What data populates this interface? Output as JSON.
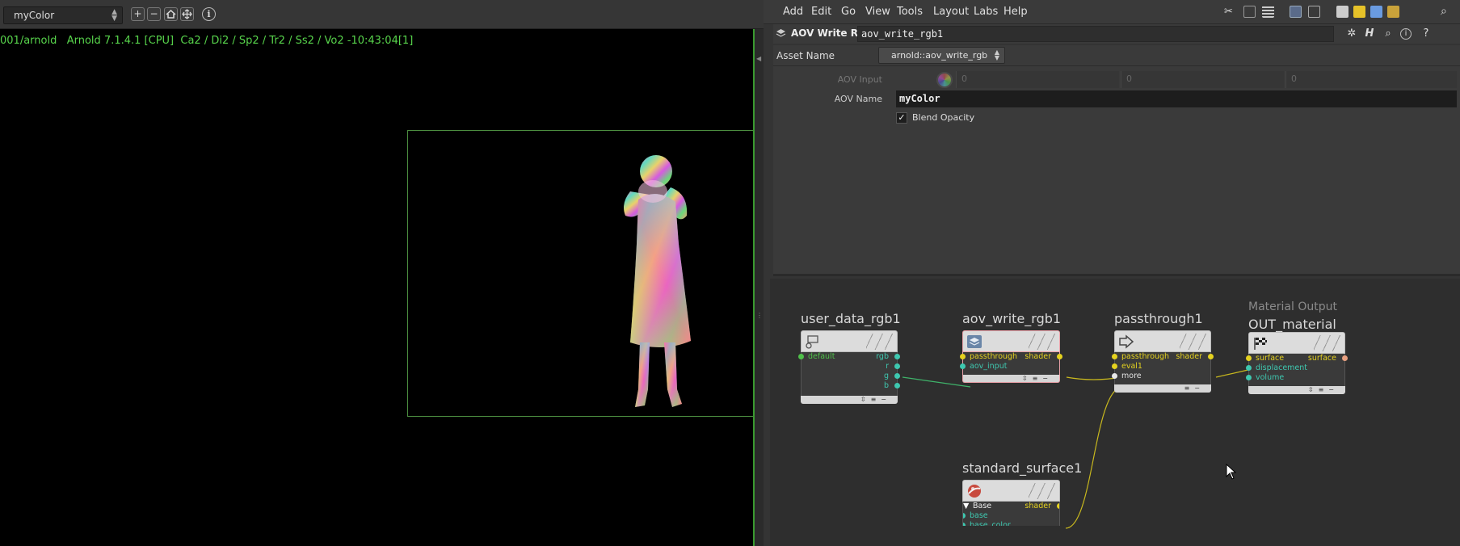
{
  "viewer": {
    "aov_select": "myColor",
    "status_line": "001/arnold   Arnold 7.1.4.1 [CPU]  Ca2 / Di2 / Sp2 / Tr2 / Ss2 / Vo2 -10:43:04[1]",
    "toolbar_icons": [
      "zoom-in-icon",
      "zoom-out-icon",
      "home-icon",
      "frame-all-icon",
      "info-icon"
    ],
    "info_glyph": "i"
  },
  "menubar": {
    "items": [
      "Add",
      "Edit",
      "Go",
      "View",
      "Tools",
      "Layout",
      "Labs",
      "Help"
    ]
  },
  "node_header": {
    "type_label": "AOV Write RGB",
    "node_name": "aov_write_rgb1"
  },
  "asset": {
    "label": "Asset Name",
    "value": "arnold::aov_write_rgb"
  },
  "params": {
    "aov_input_label": "AOV Input",
    "aov_input_values": [
      "0",
      "0",
      "0"
    ],
    "aov_name_label": "AOV Name",
    "aov_name_value": "myColor",
    "blend_opacity_label": "Blend Opacity",
    "blend_opacity_checked": true
  },
  "network": {
    "nodes": {
      "user_data": {
        "title": "user_data_rgb1",
        "inputs": [
          "default"
        ],
        "outputs": [
          "rgb",
          "r",
          "g",
          "b"
        ]
      },
      "aov_write": {
        "title": "aov_write_rgb1",
        "inputs": [
          "passthrough",
          "aov_input"
        ],
        "outputs": [
          "shader"
        ]
      },
      "passthrough": {
        "title": "passthrough1",
        "inputs": [
          "passthrough",
          "eval1",
          "more"
        ],
        "outputs": [
          "shader"
        ]
      },
      "out_material": {
        "subtitle": "Material Output",
        "title": "OUT_material",
        "inputs": [
          "surface",
          "displacement",
          "volume"
        ],
        "outputs": [
          "surface"
        ]
      },
      "standard_surface": {
        "title": "standard_surface1",
        "inputs": [
          "Base",
          "base",
          "base_color"
        ],
        "outputs": [
          "shader"
        ]
      }
    },
    "colors": {
      "port_yellow": "#e5d21f",
      "port_teal": "#3ec8b0",
      "port_green": "#4fc04a",
      "port_orange": "#e8a080",
      "selection": "#e7a0a7",
      "wire": "#c8b81e",
      "render_text": "#58d54c"
    }
  }
}
